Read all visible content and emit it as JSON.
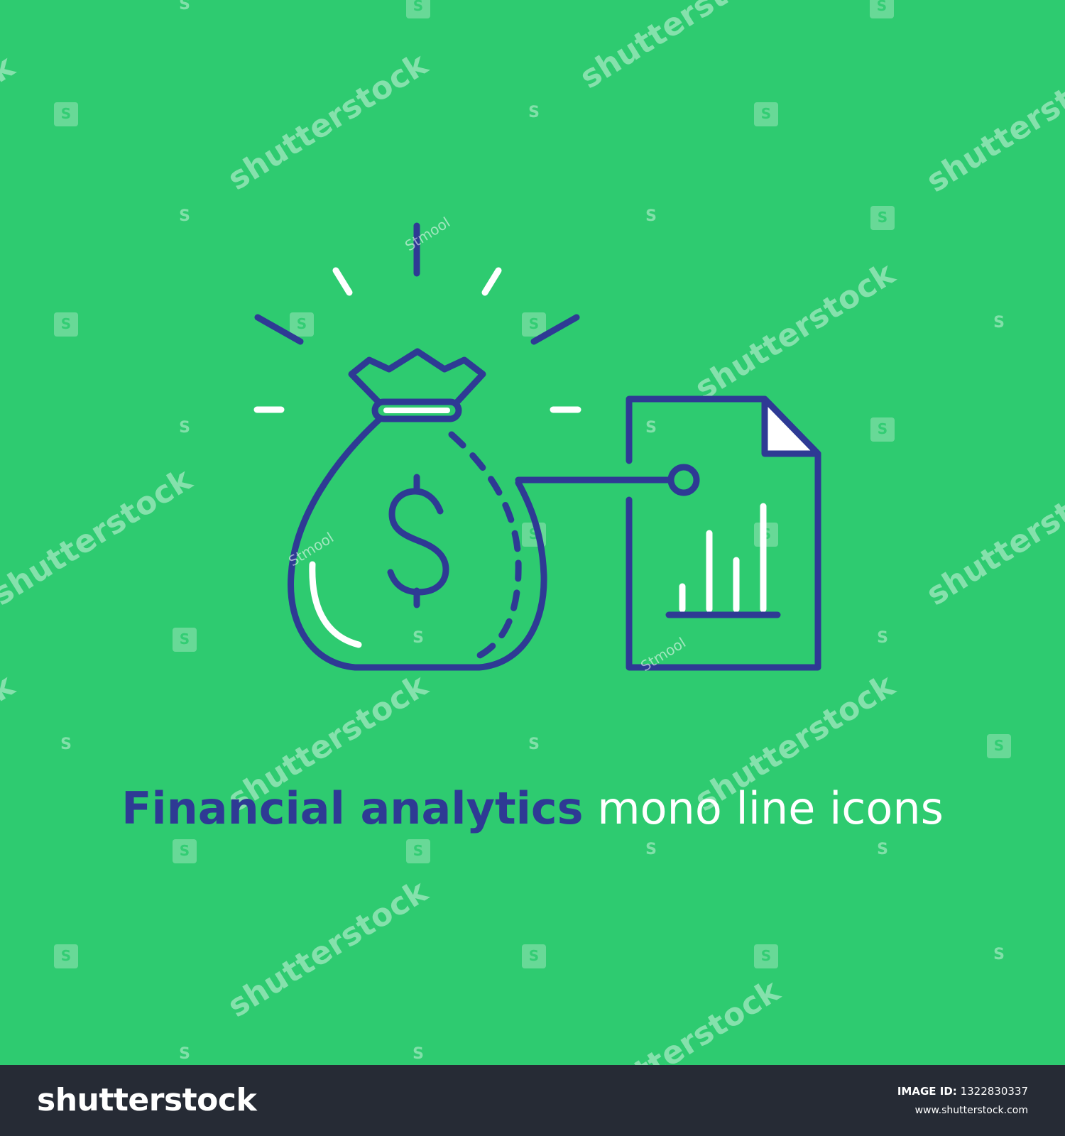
{
  "caption": {
    "bold": "Financial analytics",
    "light": "mono line icons"
  },
  "watermark": {
    "text": "shutterstock",
    "author": "Stmool"
  },
  "footer": {
    "logo": "shutterstock",
    "image_id_label": "IMAGE ID:",
    "image_id": "1322830337",
    "url": "www.shutterstock.com"
  },
  "icons": [
    "money-bag-icon",
    "dollar-sign-icon",
    "report-document-icon",
    "bar-chart-icon"
  ],
  "colors": {
    "background": "#2ecb70",
    "navy": "#2e3a94",
    "white": "#ffffff",
    "footer": "#262b35"
  }
}
